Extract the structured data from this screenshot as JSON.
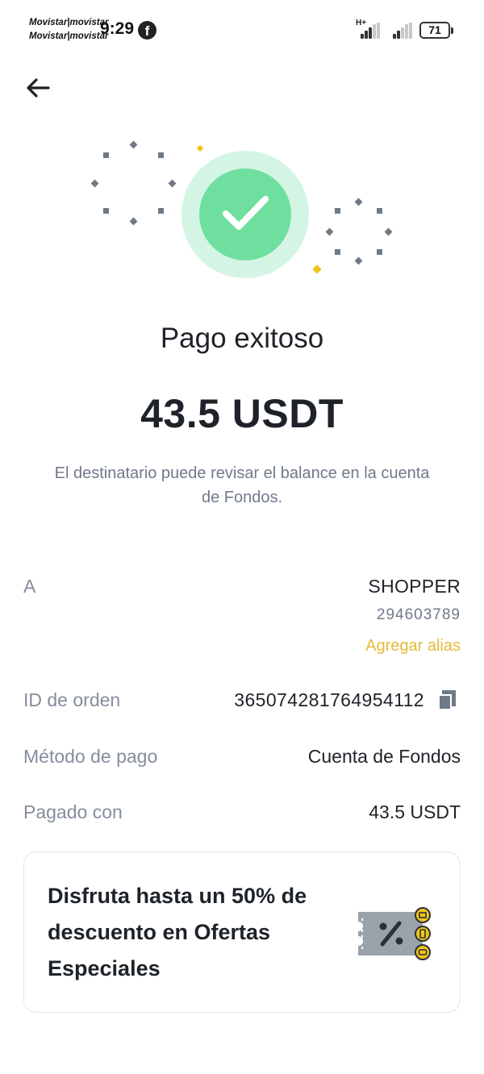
{
  "status_bar": {
    "carrier_line1": "Movistar|movistar",
    "carrier_line2": "Movistar|movistar",
    "time": "9:29",
    "app_icon": "facebook-icon",
    "network_type": "H+",
    "battery": "71"
  },
  "nav": {
    "back_icon": "back-arrow-icon"
  },
  "hero": {
    "icon": "check-circle-icon",
    "title": "Pago exitoso",
    "amount": "43.5 USDT",
    "note": "El destinatario puede revisar el balance en la cuenta de Fondos."
  },
  "details": {
    "to_label": "A",
    "recipient_name": "SHOPPER",
    "recipient_id": "294603789",
    "add_alias": "Agregar alias",
    "order_label": "ID de orden",
    "order_id": "365074281764954112",
    "method_label": "Método de pago",
    "method_value": "Cuenta de Fondos",
    "paid_label": "Pagado con",
    "paid_value": "43.5 USDT"
  },
  "promo": {
    "text": "Disfruta hasta un 50% de descuento en Ofertas Especiales",
    "icon": "discount-coupon-icon"
  },
  "colors": {
    "success_green": "#6fdf9f",
    "success_ring": "#d4f5e4",
    "accent_yellow": "#e6b93a",
    "text_primary": "#1e2329",
    "text_secondary": "#848e9c"
  }
}
